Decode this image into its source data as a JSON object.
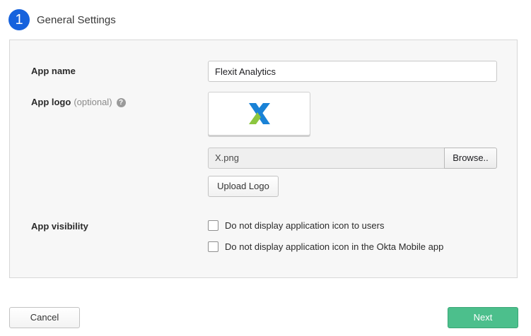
{
  "step": {
    "number": "1",
    "title": "General Settings"
  },
  "form": {
    "app_name": {
      "label": "App name",
      "value": "Flexit Analytics"
    },
    "app_logo": {
      "label": "App logo",
      "optional": "(optional)",
      "help_icon": "?",
      "logo_icon": "x-logo-icon",
      "file_name": "X.png",
      "browse_label": "Browse..",
      "upload_label": "Upload Logo"
    },
    "app_visibility": {
      "label": "App visibility",
      "options": [
        {
          "label": "Do not display application icon to users",
          "checked": false
        },
        {
          "label": "Do not display application icon in the Okta Mobile app",
          "checked": false
        }
      ]
    }
  },
  "footer": {
    "cancel_label": "Cancel",
    "next_label": "Next"
  },
  "colors": {
    "accent": "#1662dd",
    "next": "#4cbf8c",
    "logo_blue": "#1a82d6",
    "logo_green": "#8cc63f"
  }
}
